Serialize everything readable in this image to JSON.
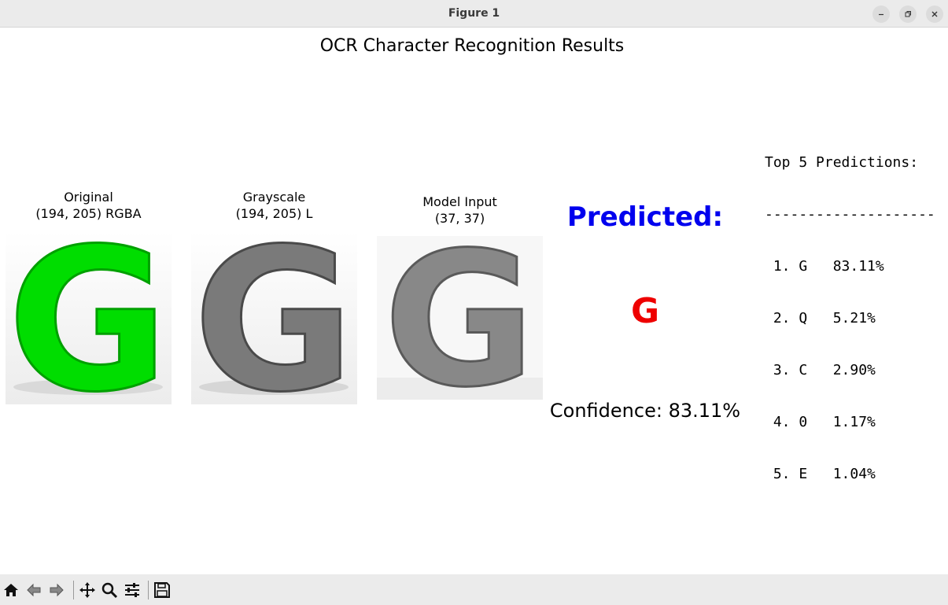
{
  "window": {
    "title": "Figure 1"
  },
  "figure": {
    "title": "OCR Character Recognition Results",
    "panels": [
      {
        "title_line1": "Original",
        "title_line2": "(194, 205) RGBA",
        "letter": "G",
        "letter_color": "#00dd00"
      },
      {
        "title_line1": "Grayscale",
        "title_line2": "(194, 205) L",
        "letter": "G",
        "letter_color": "#7a7a7a"
      },
      {
        "title_line1": "Model Input",
        "title_line2": "(37, 37)",
        "letter": "G",
        "letter_color": "#888888"
      }
    ],
    "predicted_label": "Predicted:",
    "predicted_char": "G",
    "confidence": "Confidence: 83.11%",
    "top5": {
      "header": "Top 5 Predictions:",
      "divider": "--------------------",
      "rows": [
        " 1. G   83.11%",
        " 2. Q   5.21%",
        " 3. C   2.90%",
        " 4. 0   1.17%",
        " 5. E   1.04%"
      ]
    }
  },
  "colors": {
    "predicted_label": "#0000ee",
    "predicted_char": "#ee0000",
    "original_letter": "#00dd00"
  },
  "toolbar": {
    "icons": [
      "home-icon",
      "back-icon",
      "forward-icon",
      "pan-icon",
      "zoom-icon",
      "configure-subplots-icon",
      "save-icon"
    ]
  }
}
